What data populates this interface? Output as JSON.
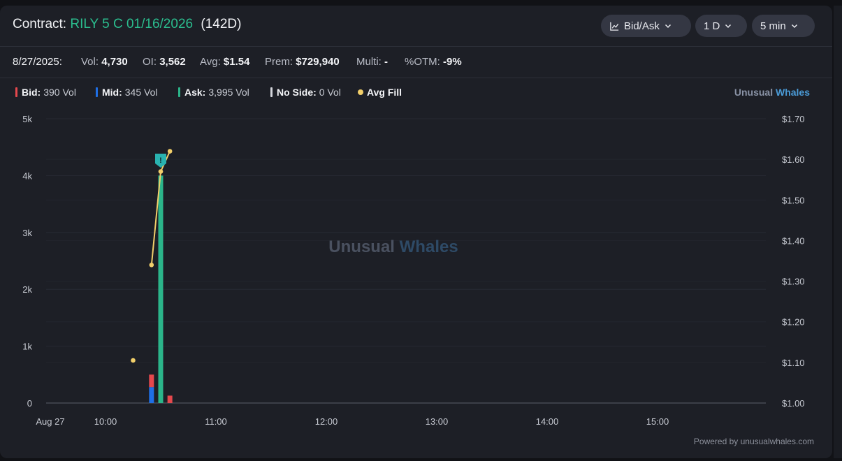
{
  "header": {
    "contract_label": "Contract:",
    "contract_name": "RILY 5 C 01/16/2026",
    "days": "(142D)",
    "controls": [
      {
        "label": "Bid/Ask",
        "icon": "line-chart-icon"
      },
      {
        "label": "1 D"
      },
      {
        "label": "5 min"
      }
    ]
  },
  "stats": {
    "date": "8/27/2025:",
    "vol_label": "Vol:",
    "vol": "4,730",
    "oi_label": "OI:",
    "oi": "3,562",
    "avg_label": "Avg:",
    "avg": "$1.54",
    "prem_label": "Prem:",
    "prem": "$729,940",
    "multi_label": "Multi:",
    "multi": "-",
    "otm_label": "%OTM:",
    "otm": "-9%"
  },
  "legend": {
    "items": [
      {
        "label": "Bid:",
        "value": "390 Vol",
        "color": "#e5484d"
      },
      {
        "label": "Mid:",
        "value": "345 Vol",
        "color": "#1f6fe5"
      },
      {
        "label": "Ask:",
        "value": "3,995 Vol",
        "color": "#2bb58a"
      },
      {
        "label": "No Side:",
        "value": "0 Vol",
        "color": "#d4d6dc"
      },
      {
        "label": "Avg Fill",
        "value": "",
        "color": "#f2cf6a"
      }
    ]
  },
  "brand": {
    "part1": "Unusual",
    "part2": "Whales"
  },
  "watermark": {
    "part1": "Unusual",
    "part2": "Whales"
  },
  "footer": {
    "powered": "Powered by unusualwhales.com"
  },
  "chart_data": {
    "type": "bar",
    "x_axis": {
      "ticks": [
        "Aug 27",
        "10:00",
        "11:00",
        "12:00",
        "13:00",
        "14:00",
        "15:00"
      ],
      "range_minutes": [
        565,
        955
      ]
    },
    "y_left": {
      "ticks": [
        "0",
        "1k",
        "2k",
        "3k",
        "4k",
        "5k"
      ],
      "range": [
        0,
        5000
      ]
    },
    "y_right": {
      "ticks": [
        "$1.00",
        "$1.10",
        "$1.20",
        "$1.30",
        "$1.40",
        "$1.50",
        "$1.60",
        "$1.70"
      ],
      "range": [
        1.0,
        1.7
      ]
    },
    "bars": [
      {
        "time": "10:25",
        "minutes": 625,
        "bid": 220,
        "mid": 280,
        "ask": 0
      },
      {
        "time": "10:30",
        "minutes": 630,
        "bid": 0,
        "mid": 0,
        "ask": 4000
      },
      {
        "time": "10:35",
        "minutes": 635,
        "bid": 130,
        "mid": 0,
        "ask": 0
      }
    ],
    "avg_fill_line": [
      {
        "minutes": 625,
        "price": 1.34
      },
      {
        "minutes": 630,
        "price": 1.57
      },
      {
        "minutes": 635,
        "price": 1.62
      }
    ],
    "avg_fill_points": [
      {
        "minutes": 615,
        "price": 1.105
      }
    ],
    "marker": {
      "minutes": 630,
      "symbol": "!"
    },
    "colors": {
      "bid": "#e5484d",
      "mid": "#1f6fe5",
      "ask": "#2bb58a",
      "avg": "#f2cf6a",
      "marker": "#29b3b0",
      "grid": "#272a33",
      "axis": "#8a8e99"
    }
  }
}
